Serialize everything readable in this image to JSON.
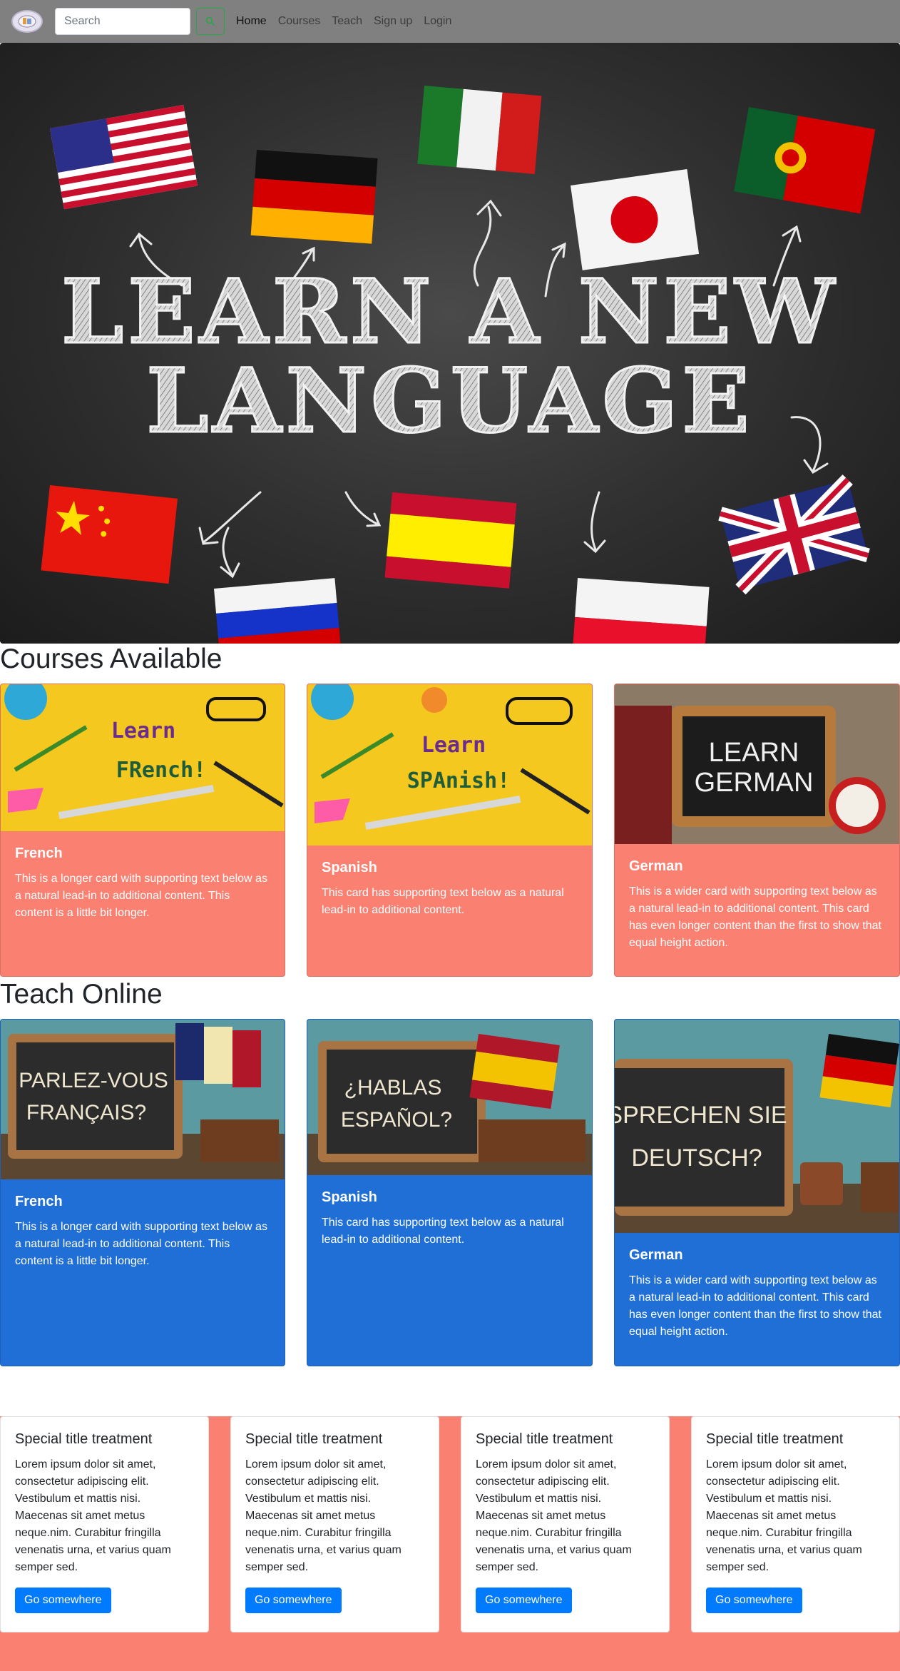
{
  "navbar": {
    "search_placeholder": "Search",
    "links": [
      "Home",
      "Courses",
      "Teach",
      "Sign up",
      "Login"
    ]
  },
  "hero": {
    "line1": "LEARN A NEW",
    "line2": "LANGUAGE"
  },
  "courses": {
    "title": "Courses Available",
    "cards": [
      {
        "image_text": [
          "Learn",
          "FRench!"
        ],
        "title": "French",
        "text": "This is a longer card with supporting text below as a natural lead-in to additional content. This content is a little bit longer."
      },
      {
        "image_text": [
          "Learn",
          "SPAnish!"
        ],
        "title": "Spanish",
        "text": "This card has supporting text below as a natural lead-in to additional content."
      },
      {
        "image_text": [
          "LEARN",
          "GERMAN"
        ],
        "title": "German",
        "text": "This is a wider card with supporting text below as a natural lead-in to additional content. This card has even longer content than the first to show that equal height action."
      }
    ]
  },
  "teach": {
    "title": "Teach Online",
    "cards": [
      {
        "image_text": [
          "PARLEZ-VOUS",
          "FRANÇAIS?"
        ],
        "title": "French",
        "text": "This is a longer card with supporting text below as a natural lead-in to additional content. This content is a little bit longer."
      },
      {
        "image_text": [
          "¿HABLAS",
          "ESPAÑOL?"
        ],
        "title": "Spanish",
        "text": "This card has supporting text below as a natural lead-in to additional content."
      },
      {
        "image_text": [
          "SPRECHEN SIE",
          "DEUTSCH?"
        ],
        "title": "German",
        "text": "This is a wider card with supporting text below as a natural lead-in to additional content. This card has even longer content than the first to show that equal height action."
      }
    ]
  },
  "specials": [
    {
      "title": "Special title treatment",
      "text": "Lorem ipsum dolor sit amet, consectetur adipiscing elit. Vestibulum et mattis nisi. Maecenas sit amet metus neque.nim. Curabitur fringilla venenatis urna, et varius quam semper sed.",
      "button": "Go somewhere"
    },
    {
      "title": "Special title treatment",
      "text": "Lorem ipsum dolor sit amet, consectetur adipiscing elit. Vestibulum et mattis nisi. Maecenas sit amet metus neque.nim. Curabitur fringilla venenatis urna, et varius quam semper sed.",
      "button": "Go somewhere"
    },
    {
      "title": "Special title treatment",
      "text": "Lorem ipsum dolor sit amet, consectetur adipiscing elit. Vestibulum et mattis nisi. Maecenas sit amet metus neque.nim. Curabitur fringilla venenatis urna, et varius quam semper sed.",
      "button": "Go somewhere"
    },
    {
      "title": "Special title treatment",
      "text": "Lorem ipsum dolor sit amet, consectetur adipiscing elit. Vestibulum et mattis nisi. Maecenas sit amet metus neque.nim. Curabitur fringilla venenatis urna, et varius quam semper sed.",
      "button": "Go somewhere"
    }
  ],
  "colors": {
    "navbar": "#808080",
    "salmon": "#fa8072",
    "blue_card": "#1f6fd6",
    "primary_button": "#007bff",
    "search_button_border": "#28a745"
  },
  "icons": {
    "logo": "globe-logo-icon",
    "search_button": "search-icon"
  }
}
